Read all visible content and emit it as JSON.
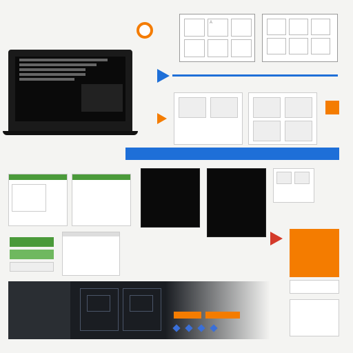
{
  "logo": {
    "shape": "circle",
    "color": "#f47c00"
  },
  "arrows": [
    {
      "color": "#1e6fd8"
    },
    {
      "color": "#f47c00"
    },
    {
      "color": "#d43a2a"
    },
    {
      "color": "#d43a2a"
    }
  ],
  "laptop": {
    "title_lines": [
      "",
      "",
      "",
      "",
      ""
    ],
    "caption": ""
  },
  "wireframes_top": {
    "cells": [
      "A",
      "",
      "",
      "",
      "",
      ""
    ]
  },
  "label_a": "",
  "label_b": "",
  "orange_tag": "",
  "promo_lines": [
    "",
    ""
  ],
  "panel_blue_label": "",
  "panel_green": {
    "buttons": [
      "",
      "",
      ""
    ]
  },
  "console_center": {
    "title": ""
  },
  "console_right": {
    "lines": [
      "",
      "",
      "",
      ""
    ]
  },
  "right_text_block": {
    "lines": [
      "",
      ""
    ]
  },
  "hud": {
    "label": ""
  },
  "strip_blue": {
    "items": [
      "",
      ""
    ]
  }
}
